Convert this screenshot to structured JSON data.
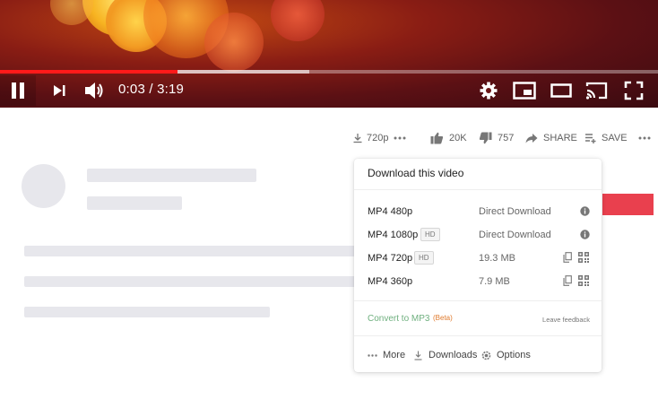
{
  "player": {
    "current_time": "0:03",
    "duration": "3:19",
    "time_display": "0:03 / 3:19",
    "played_fraction": 0.27,
    "buffered_fraction": 0.47,
    "accent_color": "#ff1a1a"
  },
  "meta": {
    "quality": "720p",
    "likes": "20K",
    "dislikes": "757",
    "share_label": "SHARE",
    "save_label": "SAVE"
  },
  "download_popup": {
    "title": "Download this video",
    "rows": [
      {
        "format": "MP4 480p",
        "badge": "",
        "action": "Direct Download",
        "icon": "info-icon"
      },
      {
        "format": "MP4 1080p",
        "badge": "HD",
        "action": "Direct Download",
        "icon": "info-icon"
      },
      {
        "format": "MP4 720p",
        "badge": "HD",
        "action": "19.3 MB",
        "icon": "copy-qr-icons"
      },
      {
        "format": "MP4 360p",
        "badge": "",
        "action": "7.9 MB",
        "icon": "copy-qr-icons"
      }
    ],
    "convert_label": "Convert to MP3",
    "beta_label": "(Beta)",
    "feedback_label": "Leave feedback",
    "bottom": {
      "more": "More",
      "downloads": "Downloads",
      "options": "Options"
    }
  }
}
